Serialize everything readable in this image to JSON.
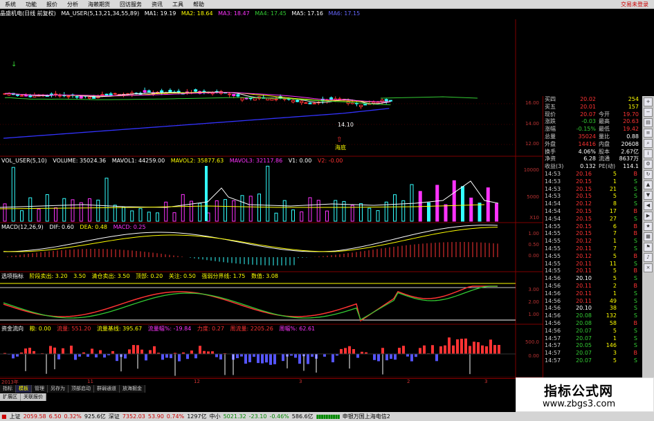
{
  "menu": [
    "系统",
    "功能",
    "报价",
    "分析",
    "海赖期货",
    "回访服务",
    "资讯",
    "工具",
    "帮助"
  ],
  "login_text": "交易未登录",
  "main_title": {
    "name": "晶盛机电(日线 前复权)",
    "indicator": "MA_USER(5,13,21,34,55,89)",
    "ma1": "MA1: 19.19",
    "ma2": "MA2: 18.64",
    "ma3": "MA3: 18.47",
    "ma4": "MA4: 17.45",
    "ma5": "MA5: 17.16",
    "ma6": "MA6: 17.15"
  },
  "price_axis": [
    "16.00",
    "14.00",
    "12.00"
  ],
  "price_labels": {
    "low_value": "14.10",
    "bottom_label": "海底",
    "arrow": "↓"
  },
  "vol_title": {
    "name": "VOL_USER(5,10)",
    "volume": "VOLUME: 35024.36",
    "mavol1": "MAVOL1: 44259.00",
    "mavol2": "MAVOL2: 35877.63",
    "mavol3": "MAVOL3: 32117.86",
    "v1": "V1: 0.00",
    "v2": "V2: -0.00"
  },
  "vol_axis": [
    "10000",
    "5000",
    "X10"
  ],
  "macd_title": {
    "name": "MACD(12,26,9)",
    "dif": "DIF: 0.60",
    "dea": "DEA: 0.48",
    "macd": "MACD: 0.25"
  },
  "macd_axis": [
    "1.00",
    "0.50",
    "0.00"
  ],
  "sel_title": {
    "name": "选项指标",
    "a": "阶段卖出: 3.20",
    "b": "3.50",
    "c": "清仓卖出: 3.50",
    "d": "顶部: 0.20",
    "e": "关注: 0.50",
    "f": "强弱分界线: 1.75",
    "g": "数值: 3.08"
  },
  "sel_axis": [
    "3.00",
    "2.00",
    "1.00"
  ],
  "fund_title": {
    "name": "资金流向",
    "a": "粮: 0.00",
    "b": "流量: 551.20",
    "c": "流量基线: 395.67",
    "d": "流量幅%: -19.84",
    "e": "力度: 0.27",
    "f": "周流量: 2205.26",
    "g": "周幅%: 62.61"
  },
  "fund_axis": [
    "500.0",
    "0.00"
  ],
  "timeline": [
    "2013年",
    "11",
    "12",
    "3",
    "2",
    "3"
  ],
  "tabs": [
    "指标",
    "模板",
    "管理",
    "另存为",
    "顶部启动",
    "群弱通道",
    "放海掘金"
  ],
  "tabs2": [
    "扩展区",
    "关联报价"
  ],
  "quote": [
    {
      "l": "买四",
      "v": "20.02",
      "l2": "",
      "v2": "254"
    },
    {
      "l": "买五",
      "v": "20.01",
      "l2": "",
      "v2": "157"
    },
    {
      "l": "现价",
      "v": "20.07",
      "l2": "今开",
      "v2": "19.70"
    },
    {
      "l": "涨跌",
      "v": "-0.03",
      "l2": "最高",
      "v2": "20.63"
    },
    {
      "l": "涨幅",
      "v": "-0.15%",
      "l2": "最低",
      "v2": "19.42"
    },
    {
      "l": "总量",
      "v": "35024",
      "l2": "量比",
      "v2": "0.88"
    },
    {
      "l": "外盘",
      "v": "14416",
      "l2": "内盘",
      "v2": "20608"
    },
    {
      "l": "换手",
      "v": "4.06%",
      "l2": "股本",
      "v2": "2.67亿"
    },
    {
      "l": "净资",
      "v": "6.28",
      "l2": "流通",
      "v2": "8637万"
    },
    {
      "l": "收益(3)",
      "v": "0.132",
      "l2": "PE(动)",
      "v2": "114.1"
    }
  ],
  "ticks": [
    [
      "14:53",
      "20.16",
      "5",
      "B"
    ],
    [
      "14:53",
      "20.15",
      "1",
      "S"
    ],
    [
      "14:53",
      "20.15",
      "21",
      "S"
    ],
    [
      "14:53",
      "20.15",
      "5",
      "S"
    ],
    [
      "14:54",
      "20.12",
      "8",
      "S"
    ],
    [
      "14:54",
      "20.15",
      "17",
      "B"
    ],
    [
      "14:54",
      "20.15",
      "27",
      "S"
    ],
    [
      "14:55",
      "20.15",
      "6",
      "B"
    ],
    [
      "14:55",
      "20.15",
      "7",
      "B"
    ],
    [
      "14:55",
      "20.12",
      "1",
      "S"
    ],
    [
      "14:55",
      "20.11",
      "7",
      "S"
    ],
    [
      "14:55",
      "20.12",
      "5",
      "B"
    ],
    [
      "14:55",
      "20.11",
      "11",
      "S"
    ],
    [
      "14:55",
      "20.11",
      "5",
      "B"
    ],
    [
      "14:56",
      "20.10",
      "5",
      "S"
    ],
    [
      "14:56",
      "20.11",
      "2",
      "B"
    ],
    [
      "14:56",
      "20.11",
      "1",
      "S"
    ],
    [
      "14:56",
      "20.11",
      "49",
      "S"
    ],
    [
      "14:56",
      "20.10",
      "38",
      "S"
    ],
    [
      "14:56",
      "20.08",
      "132",
      "S"
    ],
    [
      "14:56",
      "20.08",
      "58",
      "B"
    ],
    [
      "14:56",
      "20.07",
      "5",
      "S"
    ],
    [
      "14:57",
      "20.07",
      "1",
      "S"
    ],
    [
      "14:57",
      "20.05",
      "146",
      "S"
    ],
    [
      "14:57",
      "20.07",
      "3",
      "B"
    ],
    [
      "14:57",
      "20.07",
      "5",
      "S"
    ]
  ],
  "status": {
    "sh_label": "上证",
    "sh_val": "2059.58",
    "sh_chg": "6.50",
    "sh_pct": "0.32%",
    "sh_amt": "925.6亿",
    "sz_label": "深证",
    "sz_val": "7352.03",
    "sz_chg": "53.90",
    "sz_pct": "0.74%",
    "sz_amt": "1297亿",
    "zx_label": "中小",
    "zx_val": "5021.32",
    "zx_chg": "-23.10",
    "zx_pct": "-0.46%",
    "zx_amt": "586.6亿",
    "broker": "申银万国上海电信2"
  },
  "watermark": {
    "title": "指标公式网",
    "url": "www.zbgs3.com"
  },
  "colors": {
    "up": "#ff3333",
    "down": "#33ffff",
    "ma1": "#ffffff",
    "ma2": "#ffff00",
    "ma3": "#ff33ff",
    "ma4": "#33cc33",
    "ma5": "#3333ff",
    "grid": "#800000"
  }
}
